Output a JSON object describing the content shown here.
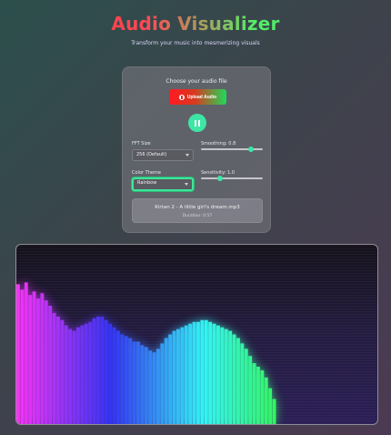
{
  "header": {
    "title": "Audio Visualizer",
    "subtitle": "Transform your music into mesmerizing visuals"
  },
  "controls": {
    "choose_label": "Choose your audio file",
    "upload_label": "Upload Audio",
    "play_state": "playing",
    "fft": {
      "label": "FFT Size",
      "value": "256 (Default)"
    },
    "smoothing": {
      "label": "Smoothing: 0.8",
      "value": 0.8
    },
    "color_theme": {
      "label": "Color Theme",
      "value": "Rainbow"
    },
    "sensitivity": {
      "label": "Sensitivity: 1.0",
      "value": 1.0,
      "min": 0.5,
      "max": 3.0
    }
  },
  "now_playing": {
    "track": "Kirtan 2 - A little girl's dream.mp3",
    "duration": "Duration: 0:57"
  },
  "visualizer": {
    "theme": "Rainbow",
    "bar_levels": [
      0.78,
      0.75,
      0.79,
      0.72,
      0.74,
      0.7,
      0.73,
      0.69,
      0.66,
      0.62,
      0.6,
      0.58,
      0.55,
      0.53,
      0.52,
      0.54,
      0.55,
      0.56,
      0.57,
      0.59,
      0.6,
      0.6,
      0.58,
      0.56,
      0.54,
      0.52,
      0.5,
      0.49,
      0.48,
      0.46,
      0.46,
      0.44,
      0.43,
      0.41,
      0.4,
      0.42,
      0.45,
      0.48,
      0.5,
      0.52,
      0.53,
      0.54,
      0.55,
      0.56,
      0.57,
      0.57,
      0.58,
      0.58,
      0.57,
      0.56,
      0.55,
      0.54,
      0.53,
      0.52,
      0.5,
      0.48,
      0.45,
      0.42,
      0.38,
      0.34,
      0.32,
      0.3,
      0.26,
      0.2,
      0.14
    ]
  }
}
